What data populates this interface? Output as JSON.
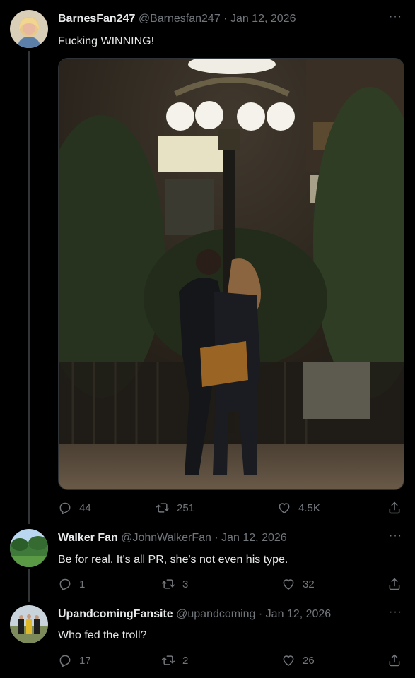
{
  "tweets": [
    {
      "display_name": "BarnesFan247",
      "handle": "@Barnesfan247",
      "date": "Jan 12, 2026",
      "text": "Fucking WINNING!",
      "replies": "44",
      "retweets": "251",
      "likes": "4.5K",
      "more_label": "···"
    },
    {
      "display_name": "Walker Fan",
      "handle": "@JohnWalkerFan",
      "date": "Jan 12, 2026",
      "text": "Be for real. It's all PR, she's not even his type.",
      "replies": "1",
      "retweets": "3",
      "likes": "32",
      "more_label": "···"
    },
    {
      "display_name": "UpandcomingFansite",
      "handle": "@upandcoming",
      "date": "Jan 12, 2026",
      "text": "Who fed the troll?",
      "replies": "17",
      "retweets": "2",
      "likes": "26",
      "more_label": "···"
    }
  ],
  "separator": " · ",
  "icons": {
    "reply": "reply-icon",
    "retweet": "retweet-icon",
    "like": "heart-icon",
    "share": "share-icon",
    "more": "more-icon"
  },
  "colors": {
    "background": "#000000",
    "text_primary": "#e7e9ea",
    "text_secondary": "#71767b",
    "thread_line": "#333639"
  }
}
